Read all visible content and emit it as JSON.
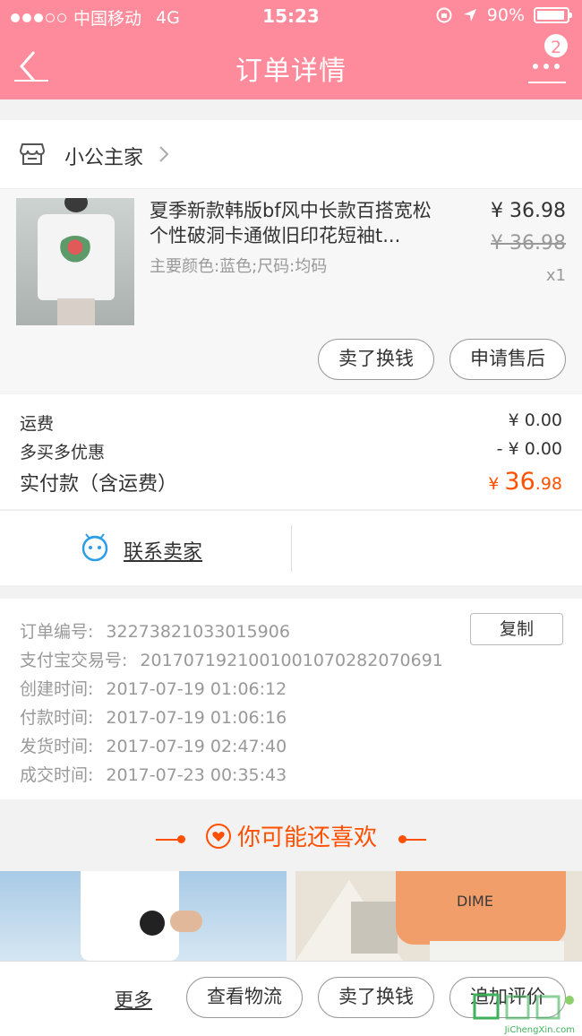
{
  "status_bar": {
    "carrier": "中国移动",
    "network": "4G",
    "time": "15:23",
    "battery": "90%"
  },
  "nav": {
    "title": "订单详情",
    "badge_count": "2"
  },
  "shop": {
    "name": "小公主家"
  },
  "product": {
    "title": "夏季新款韩版bf风中长款百搭宽松个性破洞卡通做旧印花短袖t...",
    "attrs": "主要颜色:蓝色;尺码:均码",
    "price": "¥ 36.98",
    "original_price": "¥ 36.98",
    "quantity": "x1",
    "actions": {
      "sell": "卖了换钱",
      "after_sale": "申请售后"
    }
  },
  "fees": {
    "shipping_label": "运费",
    "shipping_value": "¥ 0.00",
    "discount_label": "多买多优惠",
    "discount_value": "- ¥ 0.00",
    "total_label": "实付款（含运费）",
    "total_currency": "¥ ",
    "total_integer": "36",
    "total_decimal": ".98"
  },
  "contact": {
    "label": "联系卖家"
  },
  "order_info": {
    "copy_button": "复制",
    "rows": [
      {
        "label": "订单编号:",
        "value": "32273821033015906"
      },
      {
        "label": "支付宝交易号:",
        "value": "2017071921001001070282070691"
      },
      {
        "label": "创建时间:",
        "value": "2017-07-19 01:06:12"
      },
      {
        "label": "付款时间:",
        "value": "2017-07-19 01:06:16"
      },
      {
        "label": "发货时间:",
        "value": "2017-07-19 02:47:40"
      },
      {
        "label": "成交时间:",
        "value": "2017-07-23 00:35:43"
      }
    ]
  },
  "recommend": {
    "title": "你可能还喜欢",
    "right_image_text": "DIME"
  },
  "bottom_bar": {
    "more": "更多",
    "logistics": "查看物流",
    "sell": "卖了换钱",
    "review": "追加评价"
  },
  "watermark": {
    "text": "JiChengXin.com"
  },
  "colors": {
    "header": "#fd8b9b",
    "accent": "#ff5000",
    "contact_icon": "#2c9ee8"
  }
}
